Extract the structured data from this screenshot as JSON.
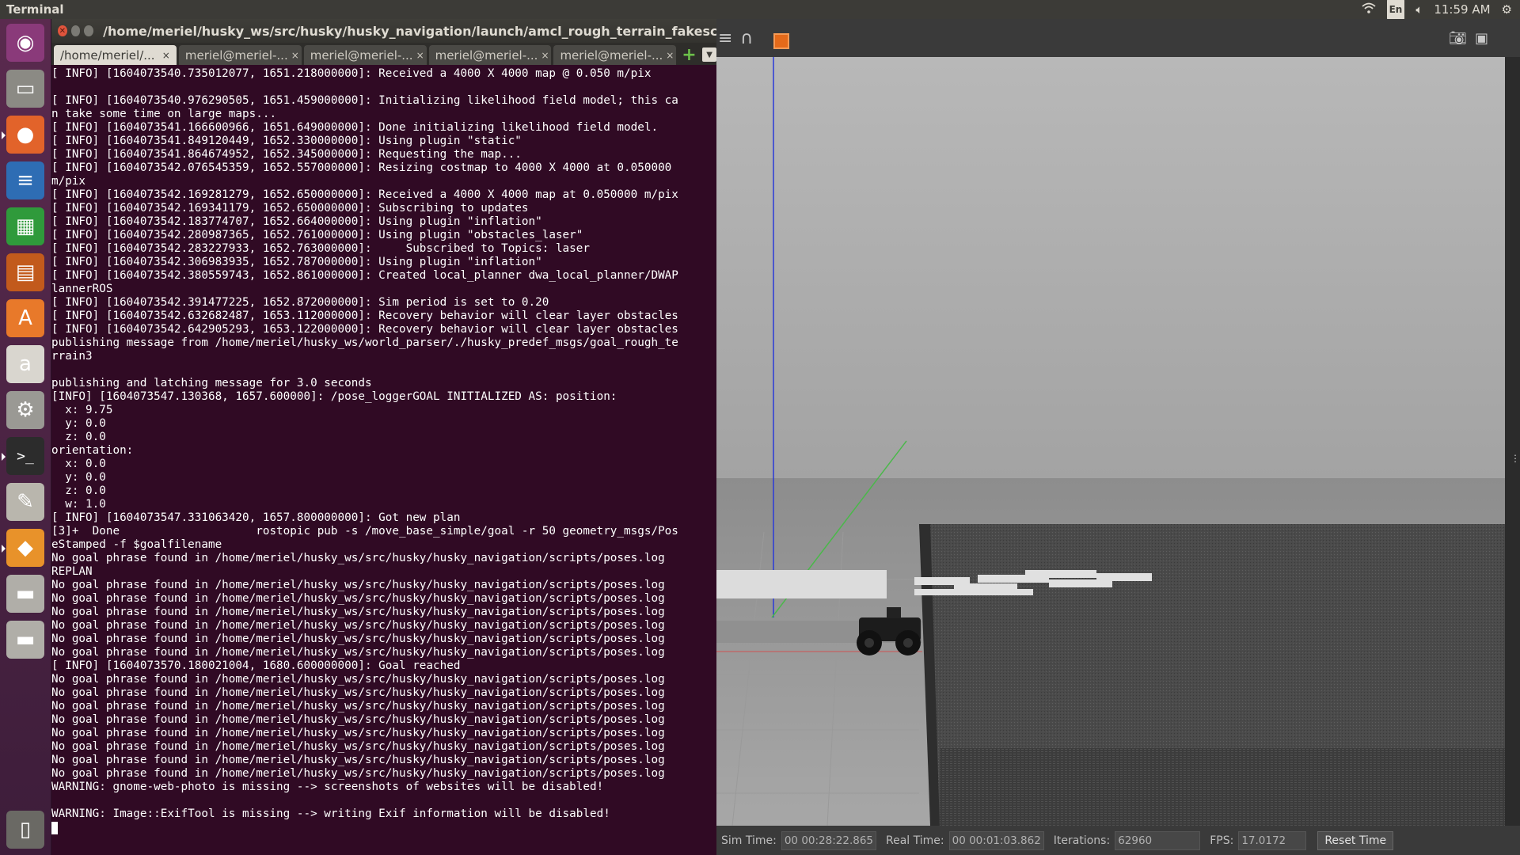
{
  "top_panel": {
    "app_title": "Terminal",
    "lang": "En",
    "clock": "11:59 AM"
  },
  "launcher": {
    "items": [
      {
        "name": "ubuntu-dash",
        "glyph": "◉",
        "bg": "#8a3a7a"
      },
      {
        "name": "files",
        "glyph": "▭",
        "bg": "#8b8a84"
      },
      {
        "name": "firefox",
        "glyph": "●",
        "bg": "#e2632a"
      },
      {
        "name": "libreoffice-writer",
        "glyph": "≡",
        "bg": "#2e6db4"
      },
      {
        "name": "libreoffice-calc",
        "glyph": "▦",
        "bg": "#2f9a3b"
      },
      {
        "name": "libreoffice-impress",
        "glyph": "▤",
        "bg": "#c25a1c"
      },
      {
        "name": "software-center",
        "glyph": "A",
        "bg": "#e8792a"
      },
      {
        "name": "amazon",
        "glyph": "a",
        "bg": "#d9d6cf"
      },
      {
        "name": "system-settings",
        "glyph": "⚙",
        "bg": "#9a9994"
      },
      {
        "name": "terminal",
        "glyph": ">_",
        "bg": "#2c2c2c"
      },
      {
        "name": "text-editor",
        "glyph": "✎",
        "bg": "#b9b6ad"
      },
      {
        "name": "gazebo",
        "glyph": "◆",
        "bg": "#e8922a"
      },
      {
        "name": "drive-1",
        "glyph": "▬",
        "bg": "#b0aea8"
      },
      {
        "name": "drive-2",
        "glyph": "▬",
        "bg": "#b0aea8"
      },
      {
        "name": "trash",
        "glyph": "▯",
        "bg": "#6a6964"
      }
    ]
  },
  "terminal": {
    "title": "/home/meriel/husky_ws/src/husky/husky_navigation/launch/amcl_rough_terrain_fakescan.launch http://",
    "tabs": [
      {
        "label": "/home/meriel/...",
        "active": true
      },
      {
        "label": "meriel@meriel-...",
        "active": false
      },
      {
        "label": "meriel@meriel-...",
        "active": false
      },
      {
        "label": "meriel@meriel-...",
        "active": false
      },
      {
        "label": "meriel@meriel-...",
        "active": false
      }
    ],
    "lines": [
      "[ INFO] [1604073540.735012077, 1651.218000000]: Received a 4000 X 4000 map @ 0.050 m/pix",
      "",
      "[ INFO] [1604073540.976290505, 1651.459000000]: Initializing likelihood field model; this ca",
      "n take some time on large maps...",
      "[ INFO] [1604073541.166600966, 1651.649000000]: Done initializing likelihood field model.",
      "[ INFO] [1604073541.849120449, 1652.330000000]: Using plugin \"static\"",
      "[ INFO] [1604073541.864674952, 1652.345000000]: Requesting the map...",
      "[ INFO] [1604073542.076545359, 1652.557000000]: Resizing costmap to 4000 X 4000 at 0.050000",
      "m/pix",
      "[ INFO] [1604073542.169281279, 1652.650000000]: Received a 4000 X 4000 map at 0.050000 m/pix",
      "[ INFO] [1604073542.169341179, 1652.650000000]: Subscribing to updates",
      "[ INFO] [1604073542.183774707, 1652.664000000]: Using plugin \"inflation\"",
      "[ INFO] [1604073542.280987365, 1652.761000000]: Using plugin \"obstacles_laser\"",
      "[ INFO] [1604073542.283227933, 1652.763000000]:     Subscribed to Topics: laser",
      "[ INFO] [1604073542.306983935, 1652.787000000]: Using plugin \"inflation\"",
      "[ INFO] [1604073542.380559743, 1652.861000000]: Created local_planner dwa_local_planner/DWAP",
      "lannerROS",
      "[ INFO] [1604073542.391477225, 1652.872000000]: Sim period is set to 0.20",
      "[ INFO] [1604073542.632682487, 1653.112000000]: Recovery behavior will clear layer obstacles",
      "[ INFO] [1604073542.642905293, 1653.122000000]: Recovery behavior will clear layer obstacles",
      "publishing message from /home/meriel/husky_ws/world_parser/./husky_predef_msgs/goal_rough_te",
      "rrain3",
      "",
      "publishing and latching message for 3.0 seconds",
      "[INFO] [1604073547.130368, 1657.600000]: /pose_loggerGOAL INITIALIZED AS: position:",
      "  x: 9.75",
      "  y: 0.0",
      "  z: 0.0",
      "orientation:",
      "  x: 0.0",
      "  y: 0.0",
      "  z: 0.0",
      "  w: 1.0",
      "[ INFO] [1604073547.331063420, 1657.800000000]: Got new plan",
      "[3]+  Done                    rostopic pub -s /move_base_simple/goal -r 50 geometry_msgs/Pos",
      "eStamped -f $goalfilename",
      "No goal phrase found in /home/meriel/husky_ws/src/husky/husky_navigation/scripts/poses.log",
      "REPLAN",
      "No goal phrase found in /home/meriel/husky_ws/src/husky/husky_navigation/scripts/poses.log",
      "No goal phrase found in /home/meriel/husky_ws/src/husky/husky_navigation/scripts/poses.log",
      "No goal phrase found in /home/meriel/husky_ws/src/husky/husky_navigation/scripts/poses.log",
      "No goal phrase found in /home/meriel/husky_ws/src/husky/husky_navigation/scripts/poses.log",
      "No goal phrase found in /home/meriel/husky_ws/src/husky/husky_navigation/scripts/poses.log",
      "No goal phrase found in /home/meriel/husky_ws/src/husky/husky_navigation/scripts/poses.log",
      "[ INFO] [1604073570.180021004, 1680.600000000]: Goal reached",
      "No goal phrase found in /home/meriel/husky_ws/src/husky/husky_navigation/scripts/poses.log",
      "No goal phrase found in /home/meriel/husky_ws/src/husky/husky_navigation/scripts/poses.log",
      "No goal phrase found in /home/meriel/husky_ws/src/husky/husky_navigation/scripts/poses.log",
      "No goal phrase found in /home/meriel/husky_ws/src/husky/husky_navigation/scripts/poses.log",
      "No goal phrase found in /home/meriel/husky_ws/src/husky/husky_navigation/scripts/poses.log",
      "No goal phrase found in /home/meriel/husky_ws/src/husky/husky_navigation/scripts/poses.log",
      "No goal phrase found in /home/meriel/husky_ws/src/husky/husky_navigation/scripts/poses.log",
      "No goal phrase found in /home/meriel/husky_ws/src/husky/husky_navigation/scripts/poses.log",
      "WARNING: gnome-web-photo is missing --> screenshots of websites will be disabled!",
      "",
      "WARNING: Image::ExifTool is missing --> writing Exif information will be disabled!",
      ""
    ]
  },
  "gazebo": {
    "sim_time_label": "Sim Time:",
    "sim_time": "00 00:28:22.865",
    "real_time_label": "Real Time:",
    "real_time": "00 00:01:03.862",
    "iterations_label": "Iterations:",
    "iterations": "62960",
    "fps_label": "FPS:",
    "fps": "17.0172",
    "reset_label": "Reset Time"
  }
}
